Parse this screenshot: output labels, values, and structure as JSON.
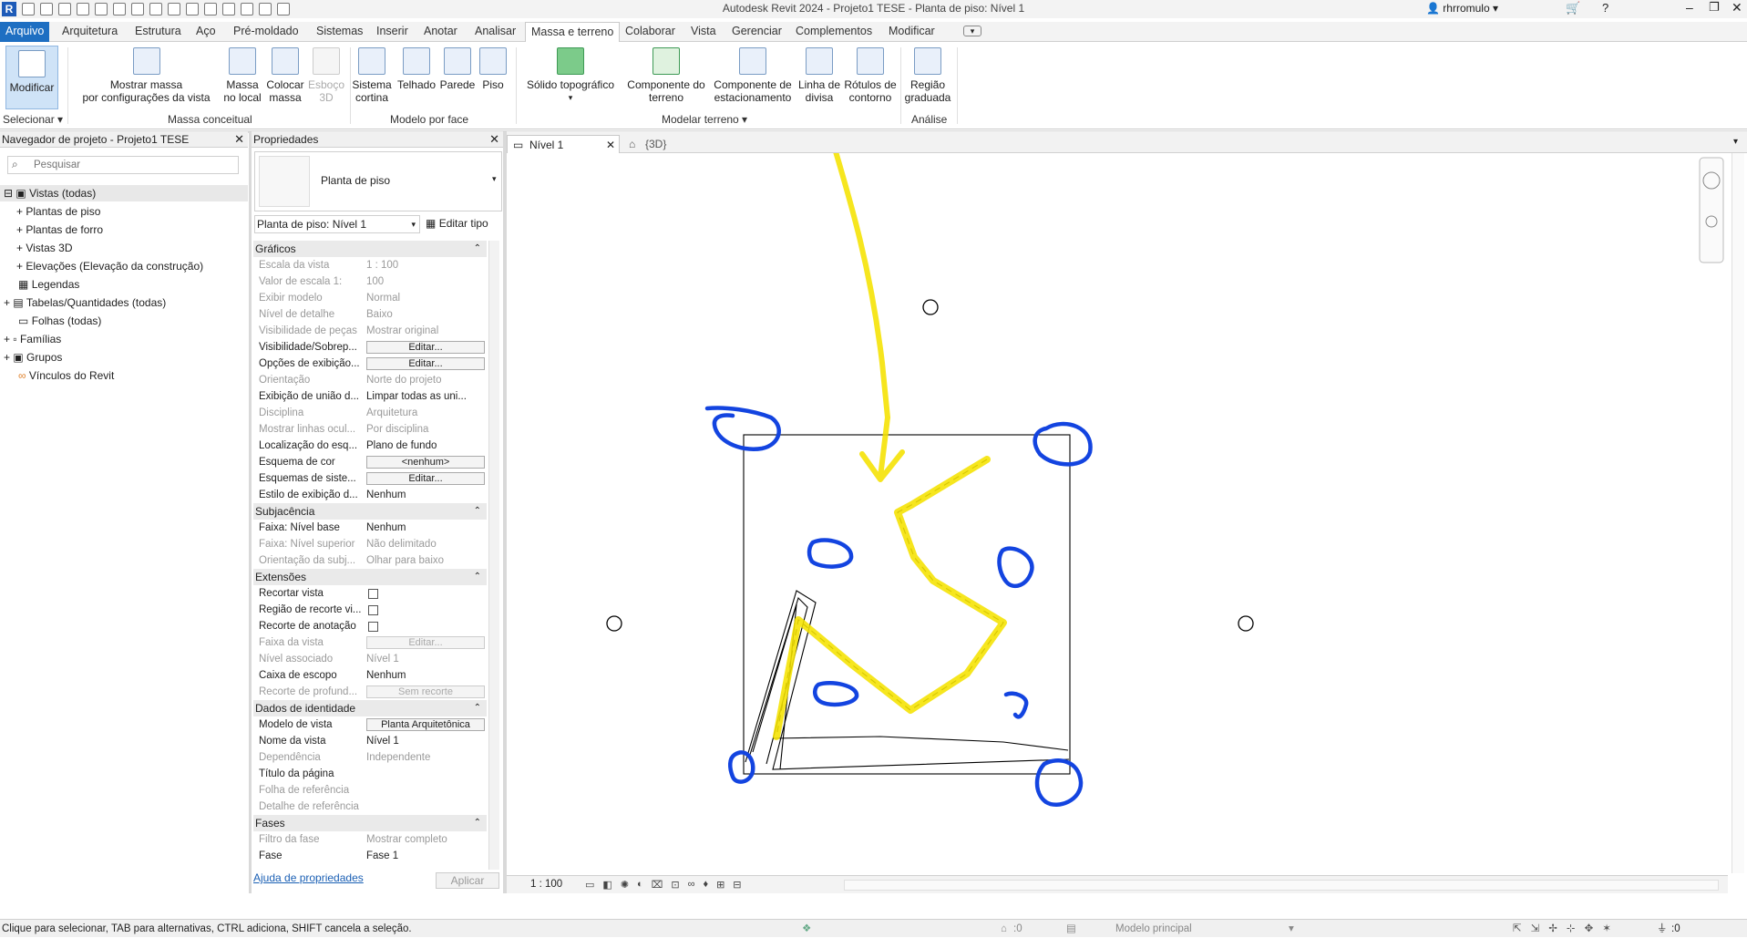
{
  "window": {
    "title": "Autodesk Revit 2024 - Projeto1 TESE - Planta de piso: Nível 1",
    "user": "rhrromulo"
  },
  "tabs": [
    "Arquivo",
    "Arquitetura",
    "Estrutura",
    "Aço",
    "Pré-moldado",
    "Sistemas",
    "Inserir",
    "Anotar",
    "Analisar",
    "Massa e terreno",
    "Colaborar",
    "Vista",
    "Gerenciar",
    "Complementos",
    "Modificar"
  ],
  "ribbon": {
    "modify": "Modificar",
    "select": "Selecionar",
    "show_mass_1": "Mostrar massa",
    "show_mass_2": "por configurações da vista",
    "inplace_1": "Massa",
    "inplace_2": "no local",
    "place_1": "Colocar",
    "place_2": "massa",
    "sketch_1": "Esboço",
    "sketch_2": "3D",
    "curtain_1": "Sistema",
    "curtain_2": "cortina",
    "roof": "Telhado",
    "wall": "Parede",
    "floor": "Piso",
    "toposolid": "Sólido topográfico",
    "sitecomp_1": "Componente do",
    "sitecomp_2": "terreno",
    "parking_1": "Componente de",
    "parking_2": "estacionamento",
    "property_1": "Linha de",
    "property_2": "divisa",
    "contour_1": "Rótulos de",
    "contour_2": "contorno",
    "graded_1": "Região",
    "graded_2": "graduada",
    "panel_conceptual": "Massa conceitual",
    "panel_byface": "Modelo por face",
    "panel_site": "Modelar terreno",
    "panel_analysis": "Análise"
  },
  "browser": {
    "title": "Navegador de projeto - Projeto1 TESE",
    "search_placeholder": "Pesquisar",
    "items": [
      "Vistas (todas)",
      "Plantas de piso",
      "Plantas de forro",
      "Vistas 3D",
      "Elevações (Elevação da construção)",
      "Legendas",
      "Tabelas/Quantidades (todas)",
      "Folhas (todas)",
      "Famílias",
      "Grupos",
      "Vínculos do Revit"
    ]
  },
  "properties": {
    "title": "Propriedades",
    "type_name": "Planta de piso",
    "instance": "Planta de piso: Nível 1",
    "edit_type": "Editar tipo",
    "sections": {
      "graphics": "Gráficos",
      "underlay": "Subjacência",
      "extents": "Extensões",
      "identity": "Dados de identidade",
      "phases": "Fases"
    },
    "graphics_rows": [
      {
        "k": "Escala da vista",
        "v": "1 : 100"
      },
      {
        "k": "Valor de escala    1:",
        "v": "100"
      },
      {
        "k": "Exibir modelo",
        "v": "Normal"
      },
      {
        "k": "Nível de detalhe",
        "v": "Baixo"
      },
      {
        "k": "Visibilidade de peças",
        "v": "Mostrar original"
      },
      {
        "k": "Visibilidade/Sobrep...",
        "v": "Editar..."
      },
      {
        "k": "Opções de exibição...",
        "v": "Editar..."
      },
      {
        "k": "Orientação",
        "v": "Norte do projeto"
      },
      {
        "k": "Exibição de união d...",
        "v": "Limpar todas as uni..."
      },
      {
        "k": "Disciplina",
        "v": "Arquitetura"
      },
      {
        "k": "Mostrar linhas ocul...",
        "v": "Por disciplina"
      },
      {
        "k": "Localização do esq...",
        "v": "Plano de fundo"
      },
      {
        "k": "Esquema de cor",
        "v": "<nenhum>"
      },
      {
        "k": "Esquemas de siste...",
        "v": "Editar..."
      },
      {
        "k": "Estilo de exibição d...",
        "v": "Nenhum"
      }
    ],
    "underlay_rows": [
      {
        "k": "Faixa: Nível base",
        "v": "Nenhum"
      },
      {
        "k": "Faixa: Nível superior",
        "v": "Não delimitado"
      },
      {
        "k": "Orientação da subj...",
        "v": "Olhar para baixo"
      }
    ],
    "extents_rows": [
      {
        "k": "Recortar vista",
        "v": ""
      },
      {
        "k": "Região de recorte vi...",
        "v": ""
      },
      {
        "k": "Recorte de anotação",
        "v": ""
      },
      {
        "k": "Faixa da vista",
        "v": "Editar..."
      },
      {
        "k": "Nível associado",
        "v": "Nível 1"
      },
      {
        "k": "Caixa de escopo",
        "v": "Nenhum"
      },
      {
        "k": "Recorte de profund...",
        "v": "Sem recorte"
      }
    ],
    "identity_rows": [
      {
        "k": "Modelo de vista",
        "v": "Planta Arquitetônica"
      },
      {
        "k": "Nome da vista",
        "v": "Nível 1"
      },
      {
        "k": "Dependência",
        "v": "Independente"
      },
      {
        "k": "Título da página",
        "v": ""
      },
      {
        "k": "Folha de referência",
        "v": ""
      },
      {
        "k": "Detalhe de referência",
        "v": ""
      }
    ],
    "phases_rows": [
      {
        "k": "Filtro da fase",
        "v": "Mostrar completo"
      },
      {
        "k": "Fase",
        "v": "Fase 1"
      }
    ],
    "help": "Ajuda de propriedades",
    "apply": "Aplicar"
  },
  "views": {
    "tab1": "Nível 1",
    "tab2": "{3D}",
    "scale": "1 : 100"
  },
  "status": {
    "hint": "Clique para selecionar, TAB para alternativas, CTRL adiciona, SHIFT cancela a seleção.",
    "zero1": ":0",
    "model": "Modelo principal",
    "zero2": ":0"
  }
}
